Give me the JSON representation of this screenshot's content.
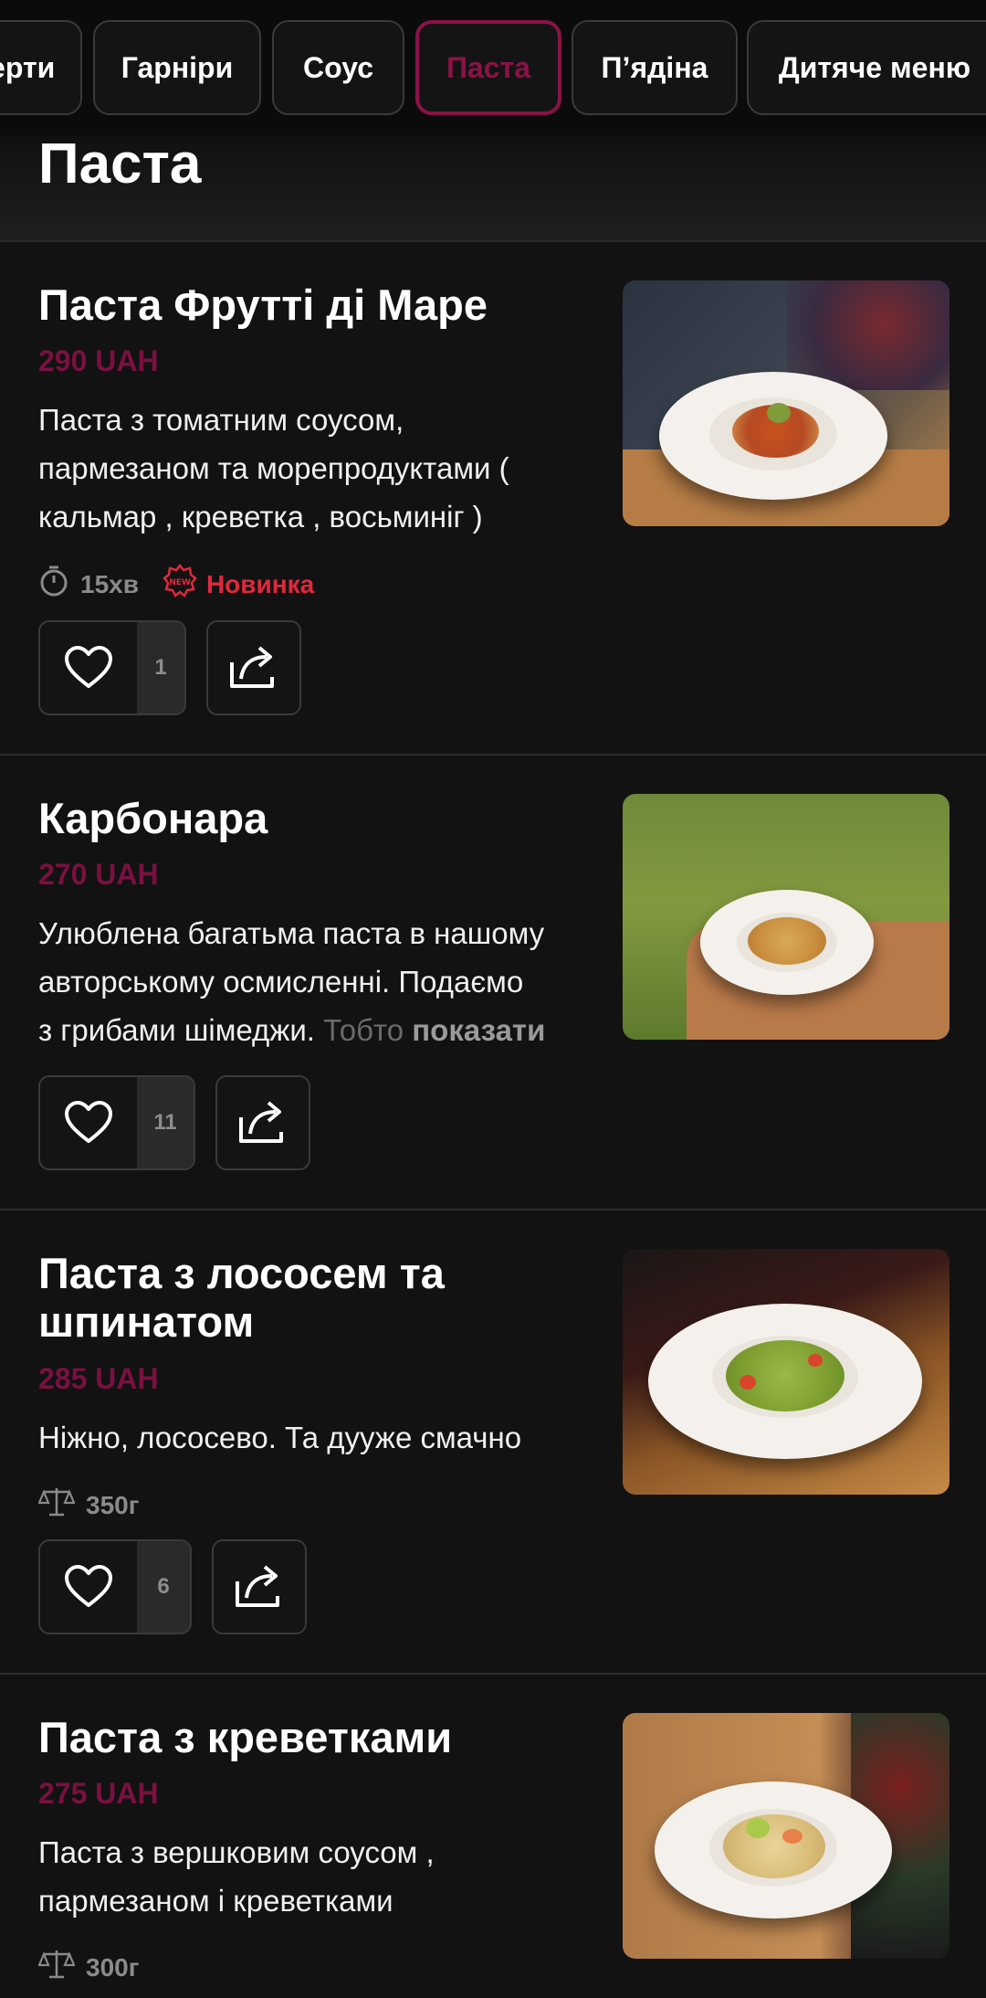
{
  "tabs": [
    {
      "label": "Десерти",
      "active": false
    },
    {
      "label": "Гарніри",
      "active": false
    },
    {
      "label": "Соус",
      "active": false
    },
    {
      "label": "Паста",
      "active": true
    },
    {
      "label": "П’ядіна",
      "active": false
    },
    {
      "label": "Дитяче меню",
      "active": false
    }
  ],
  "section": {
    "title": "Паста"
  },
  "items": [
    {
      "name": "Паста Фрутті ді Маре",
      "price": "290 UAH",
      "desc_lines": [
        "Паста з томатним соусом,",
        "пармезаном  та морепродуктами (",
        "кальмар , креветка ,  восьминіг )"
      ],
      "time": "15хв",
      "badge": "Новинка",
      "likes": "1",
      "image_icon": "pasta-seafood-photo"
    },
    {
      "name": "Карбонара",
      "price": "270 UAH",
      "desc_lines": [
        "Улюблена багатьма паста в нашому",
        "авторському осмисленні. Подаємо"
      ],
      "desc_last": "з грибами шімеджи. ",
      "desc_fade": "Тобто",
      "show_more": "показати",
      "likes": "11",
      "image_icon": "carbonara-photo"
    },
    {
      "name": "Паста з лососем та шпинатом",
      "price": "285 UAH",
      "desc_lines": [
        "Ніжно, лососево. Та дууже смачно"
      ],
      "weight": "350г",
      "likes": "6",
      "image_icon": "salmon-pasta-photo"
    },
    {
      "name": "Паста з креветками",
      "price": "275 UAH",
      "desc_lines": [
        "Паста з вершковим соусом ,",
        "пармезаном і креветками"
      ],
      "weight": "300г",
      "image_icon": "shrimp-pasta-photo"
    }
  ],
  "colors": {
    "accent": "#8a1246",
    "price": "#7a1040",
    "badge": "#e0283c",
    "background": "#121212"
  }
}
